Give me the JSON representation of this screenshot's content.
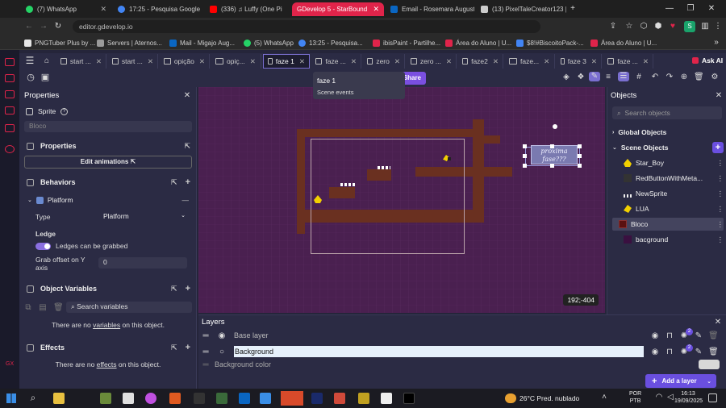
{
  "browser": {
    "tabs": [
      {
        "title": "(7) WhatsApp",
        "color": "#25d366"
      },
      {
        "title": "17:25 - Pesquisa Google",
        "color": "#4285f4"
      },
      {
        "title": "(336) ♫ Luffy (One Pi",
        "color": "#ff0000"
      },
      {
        "title": "GDevelop 5 - StarBound",
        "color": "#ffffff"
      },
      {
        "title": "Email - Rosemara August",
        "color": "#0a66c2"
      },
      {
        "title": "(13) PixelTaleCreator123 |",
        "color": "#cccccc"
      }
    ],
    "url": "editor.gdevelop.io",
    "bookmarks": [
      "PNGTuber Plus by ...",
      "Servers | Aternos...",
      "Mail - Migajo Aug...",
      "(5) WhatsApp",
      "13:25 - Pesquisa...",
      "ibisPaint - Partilhe...",
      "Área do Aluno | U...",
      "$8!#BiscoitoPack-...",
      "Área do Aluno | U..."
    ],
    "profile_letter": "S"
  },
  "scene_tabs": [
    {
      "label": "start ...",
      "active": false
    },
    {
      "label": "start ...",
      "active": false
    },
    {
      "label": "opição",
      "active": false
    },
    {
      "label": "opiç...",
      "active": false
    },
    {
      "label": "faze 1",
      "active": true
    },
    {
      "label": "faze ...",
      "active": false
    },
    {
      "label": "zero",
      "active": false
    },
    {
      "label": "zero ...",
      "active": false
    },
    {
      "label": "faze2",
      "active": false
    },
    {
      "label": "faze...",
      "active": false
    },
    {
      "label": "faze 3",
      "active": false
    },
    {
      "label": "faze ...",
      "active": false
    }
  ],
  "ask_ai": "Ask AI",
  "tooltip": {
    "title": "faze 1",
    "subtitle": "Scene events"
  },
  "share_label": "Share",
  "properties": {
    "title": "Properties",
    "object_type": "Sprite",
    "object_name_placeholder": "Bloco",
    "section_properties": "Properties",
    "edit_animations": "Edit animations",
    "section_behaviors": "Behaviors",
    "behavior_name": "Platform",
    "type_label": "Type",
    "type_value": "Platform",
    "ledge_label": "Ledge",
    "ledge_toggle_label": "Ledges can be grabbed",
    "grab_label_line1": "Grab offset on Y",
    "grab_label_line2": "axis",
    "grab_value": "0",
    "section_variables": "Object Variables",
    "search_variables": "Search variables",
    "no_vars_pre": "There are no ",
    "no_vars_link": "variables",
    "no_vars_post": " on this object.",
    "section_effects": "Effects",
    "no_fx_pre": "There are no ",
    "no_fx_link": "effects",
    "no_fx_post": " on this object."
  },
  "canvas": {
    "sign_line1": "proxima",
    "sign_line2": "fase???",
    "coords": "192;-404"
  },
  "objects": {
    "title": "Objects",
    "search_placeholder": "Search objects",
    "global_label": "Global Objects",
    "scene_label": "Scene Objects",
    "items": [
      {
        "name": "Star_Boy",
        "thumb": "#f2d000"
      },
      {
        "name": "RedButtonWithMeta...",
        "thumb": "#333333"
      },
      {
        "name": "NewSprite",
        "thumb": "#eeeeee"
      },
      {
        "name": "LUA",
        "thumb": "#f2d000"
      },
      {
        "name": "Bloco",
        "thumb": "#5a1010"
      },
      {
        "name": "bacground",
        "thumb": "#3a1040"
      }
    ]
  },
  "layers": {
    "title": "Layers",
    "base_layer": "Base layer",
    "background_layer": "Background",
    "background_color": "Background color",
    "add_layer": "Add a layer",
    "badge": "2"
  },
  "taskbar": {
    "weather": "26°C  Pred. nublado",
    "lang1": "POR",
    "lang2": "PTB",
    "time": "16:13",
    "date": "19/09/2025"
  }
}
